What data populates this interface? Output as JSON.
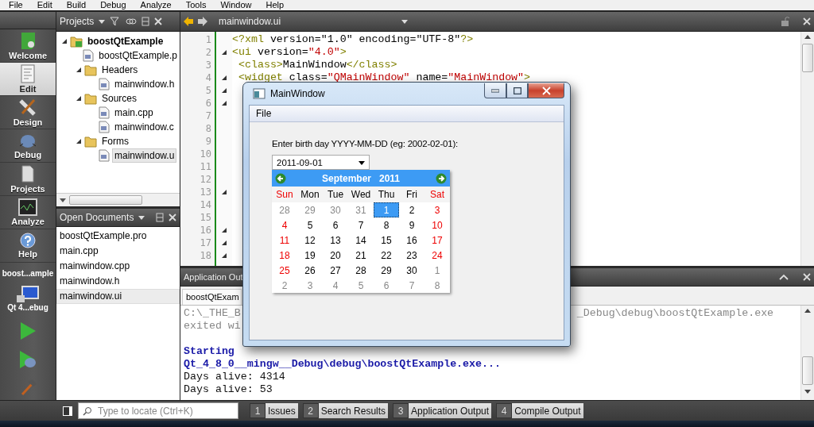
{
  "menu_bar": [
    "File",
    "Edit",
    "Build",
    "Debug",
    "Analyze",
    "Tools",
    "Window",
    "Help"
  ],
  "mode_bar": {
    "modes": [
      {
        "label": "Welcome",
        "selected": false
      },
      {
        "label": "Edit",
        "selected": true
      },
      {
        "label": "Design",
        "selected": false
      },
      {
        "label": "Debug",
        "selected": false
      },
      {
        "label": "Projects",
        "selected": false
      },
      {
        "label": "Analyze",
        "selected": false
      },
      {
        "label": "Help",
        "selected": false
      }
    ],
    "project": "boost...ample",
    "kit": "Qt 4...ebug"
  },
  "projects_pane": {
    "title": "Projects",
    "tree": [
      {
        "label": "boostQtExample",
        "kind": "project",
        "expanded": true,
        "selected": false,
        "children": [
          {
            "label": "boostQtExample.p",
            "kind": "file",
            "selected": false
          },
          {
            "label": "Headers",
            "kind": "folder",
            "expanded": true,
            "selected": false,
            "children": [
              {
                "label": "mainwindow.h",
                "kind": "file",
                "selected": false
              }
            ]
          },
          {
            "label": "Sources",
            "kind": "folder",
            "expanded": true,
            "selected": false,
            "children": [
              {
                "label": "main.cpp",
                "kind": "file",
                "selected": false
              },
              {
                "label": "mainwindow.c",
                "kind": "file",
                "selected": false
              }
            ]
          },
          {
            "label": "Forms",
            "kind": "folder",
            "expanded": true,
            "selected": false,
            "children": [
              {
                "label": "mainwindow.u",
                "kind": "file",
                "selected": true
              }
            ]
          }
        ]
      }
    ]
  },
  "open_documents": {
    "title": "Open Documents",
    "items": [
      {
        "label": "boostQtExample.pro",
        "selected": false
      },
      {
        "label": "main.cpp",
        "selected": false
      },
      {
        "label": "mainwindow.cpp",
        "selected": false
      },
      {
        "label": "mainwindow.h",
        "selected": false
      },
      {
        "label": "mainwindow.ui",
        "selected": true
      }
    ]
  },
  "editor": {
    "file": "mainwindow.ui",
    "lines": [
      {
        "number": "1",
        "fold": false,
        "tokens": [
          {
            "kind": "tag",
            "text": "<?xml"
          },
          {
            "kind": "attr",
            "text": " version=\"1.0\" encoding=\"UTF-8\""
          },
          {
            "kind": "tag",
            "text": "?>"
          }
        ]
      },
      {
        "number": "2",
        "fold": true,
        "tokens": [
          {
            "kind": "tag",
            "text": "<ui"
          },
          {
            "kind": "attr",
            "text": " version="
          },
          {
            "kind": "value",
            "text": "\"4.0\""
          },
          {
            "kind": "tag",
            "text": ">"
          }
        ]
      },
      {
        "number": "3",
        "fold": false,
        "tokens": [
          {
            "kind": "tag",
            "text": " <class>"
          },
          {
            "kind": "text",
            "text": "MainWindow"
          },
          {
            "kind": "tag",
            "text": "</class>"
          }
        ]
      },
      {
        "number": "4",
        "fold": true,
        "tokens": [
          {
            "kind": "tag",
            "text": " <widget"
          },
          {
            "kind": "attr",
            "text": " class="
          },
          {
            "kind": "value",
            "text": "\"QMainWindow\""
          },
          {
            "kind": "attr",
            "text": " name="
          },
          {
            "kind": "value",
            "text": "\"MainWindow\""
          },
          {
            "kind": "tag",
            "text": ">"
          }
        ]
      },
      {
        "number": "5",
        "fold": true
      },
      {
        "number": "6",
        "fold": true
      },
      {
        "number": "7",
        "fold": false
      },
      {
        "number": "8",
        "fold": false
      },
      {
        "number": "9",
        "fold": false
      },
      {
        "number": "10",
        "fold": false
      },
      {
        "number": "11",
        "fold": false
      },
      {
        "number": "12",
        "fold": false
      },
      {
        "number": "13",
        "fold": true
      },
      {
        "number": "14",
        "fold": false
      },
      {
        "number": "15",
        "fold": false
      },
      {
        "number": "16",
        "fold": true
      },
      {
        "number": "17",
        "fold": true
      },
      {
        "number": "18",
        "fold": true
      }
    ]
  },
  "output_pane": {
    "title": "Application Out",
    "tab": "boostQtExam",
    "lines": [
      {
        "kind": "info",
        "text": "C:\\_THE_B",
        "tail": "_Debug\\debug\\boostQtExample.exe"
      },
      {
        "kind": "info",
        "text": "exited wi"
      },
      {
        "kind": "blank"
      },
      {
        "kind": "start",
        "text": "Starting"
      },
      {
        "kind": "start",
        "text": "Qt_4_8_0__mingw__Debug\\debug\\boostQtExample.exe..."
      },
      {
        "kind": "out",
        "text": "Days alive: 4314"
      },
      {
        "kind": "out",
        "text": "Days alive: 53"
      }
    ]
  },
  "bottom_bar": {
    "locate_placeholder": "Type to locate (Ctrl+K)",
    "tabs": [
      {
        "number": "1",
        "label": "Issues"
      },
      {
        "number": "2",
        "label": "Search Results"
      },
      {
        "number": "3",
        "label": "Application Output"
      },
      {
        "number": "4",
        "label": "Compile Output"
      }
    ]
  },
  "app_window": {
    "title": "MainWindow",
    "menu": [
      "File"
    ],
    "prompt": "Enter birth day YYYY-MM-DD (eg: 2002-02-01):",
    "date_value": "2011-09-01",
    "calendar": {
      "month": "September",
      "year": "2011",
      "weekdays": [
        {
          "text": "Sun",
          "weekend": true
        },
        {
          "text": "Mon",
          "weekend": false
        },
        {
          "text": "Tue",
          "weekend": false
        },
        {
          "text": "Wed",
          "weekend": false
        },
        {
          "text": "Thu",
          "weekend": false
        },
        {
          "text": "Fri",
          "weekend": false
        },
        {
          "text": "Sat",
          "weekend": true
        }
      ],
      "weeks": [
        [
          {
            "text": "28",
            "kind": "other",
            "selected": false
          },
          {
            "text": "29",
            "kind": "other",
            "selected": false
          },
          {
            "text": "30",
            "kind": "other",
            "selected": false
          },
          {
            "text": "31",
            "kind": "other",
            "selected": false
          },
          {
            "text": "1",
            "kind": "normal",
            "selected": true
          },
          {
            "text": "2",
            "kind": "normal",
            "selected": false
          },
          {
            "text": "3",
            "kind": "weekend",
            "selected": false
          }
        ],
        [
          {
            "text": "4",
            "kind": "weekend",
            "selected": false
          },
          {
            "text": "5",
            "kind": "normal",
            "selected": false
          },
          {
            "text": "6",
            "kind": "normal",
            "selected": false
          },
          {
            "text": "7",
            "kind": "normal",
            "selected": false
          },
          {
            "text": "8",
            "kind": "normal",
            "selected": false
          },
          {
            "text": "9",
            "kind": "normal",
            "selected": false
          },
          {
            "text": "10",
            "kind": "weekend",
            "selected": false
          }
        ],
        [
          {
            "text": "11",
            "kind": "weekend",
            "selected": false
          },
          {
            "text": "12",
            "kind": "normal",
            "selected": false
          },
          {
            "text": "13",
            "kind": "normal",
            "selected": false
          },
          {
            "text": "14",
            "kind": "normal",
            "selected": false
          },
          {
            "text": "15",
            "kind": "normal",
            "selected": false
          },
          {
            "text": "16",
            "kind": "normal",
            "selected": false
          },
          {
            "text": "17",
            "kind": "weekend",
            "selected": false
          }
        ],
        [
          {
            "text": "18",
            "kind": "weekend",
            "selected": false
          },
          {
            "text": "19",
            "kind": "normal",
            "selected": false
          },
          {
            "text": "20",
            "kind": "normal",
            "selected": false
          },
          {
            "text": "21",
            "kind": "normal",
            "selected": false
          },
          {
            "text": "22",
            "kind": "normal",
            "selected": false
          },
          {
            "text": "23",
            "kind": "normal",
            "selected": false
          },
          {
            "text": "24",
            "kind": "weekend",
            "selected": false
          }
        ],
        [
          {
            "text": "25",
            "kind": "weekend",
            "selected": false
          },
          {
            "text": "26",
            "kind": "normal",
            "selected": false
          },
          {
            "text": "27",
            "kind": "normal",
            "selected": false
          },
          {
            "text": "28",
            "kind": "normal",
            "selected": false
          },
          {
            "text": "29",
            "kind": "normal",
            "selected": false
          },
          {
            "text": "30",
            "kind": "normal",
            "selected": false
          },
          {
            "text": "1",
            "kind": "other",
            "selected": false
          }
        ],
        [
          {
            "text": "2",
            "kind": "other",
            "selected": false
          },
          {
            "text": "3",
            "kind": "other",
            "selected": false
          },
          {
            "text": "4",
            "kind": "other",
            "selected": false
          },
          {
            "text": "5",
            "kind": "other",
            "selected": false
          },
          {
            "text": "6",
            "kind": "other",
            "selected": false
          },
          {
            "text": "7",
            "kind": "other",
            "selected": false
          },
          {
            "text": "8",
            "kind": "other",
            "selected": false
          }
        ]
      ]
    }
  }
}
